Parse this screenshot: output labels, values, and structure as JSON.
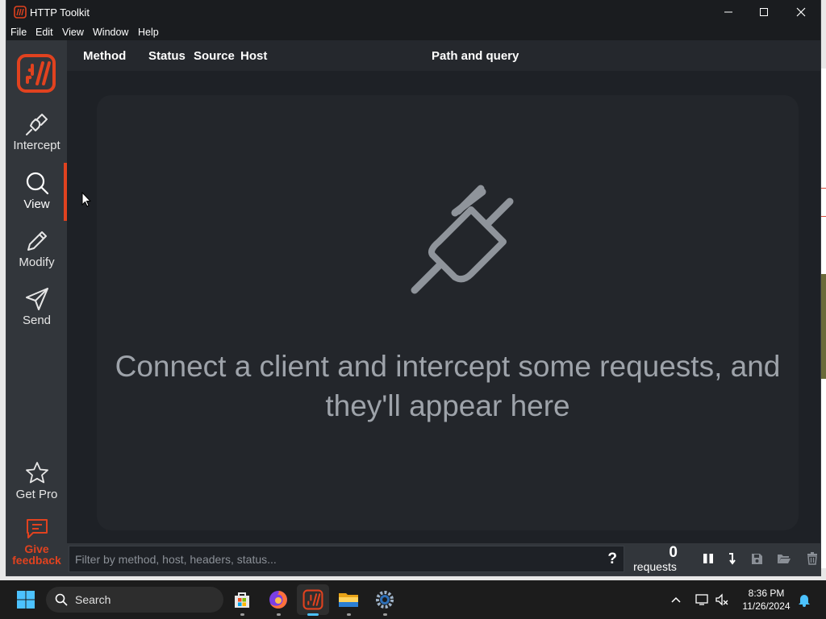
{
  "window": {
    "title": "HTTP Toolkit",
    "controls": [
      "minimize-icon",
      "maximize-icon",
      "close-icon"
    ]
  },
  "menu": [
    "File",
    "Edit",
    "View",
    "Window",
    "Help"
  ],
  "sidebar": {
    "items": [
      {
        "label": "Intercept",
        "icon": "plug-icon"
      },
      {
        "label": "View",
        "icon": "search-icon"
      },
      {
        "label": "Modify",
        "icon": "pencil-icon"
      },
      {
        "label": "Send",
        "icon": "send-icon"
      }
    ],
    "active": "View",
    "bottom": [
      {
        "label": "Get Pro",
        "icon": "star-icon"
      },
      {
        "label": "Give feedback",
        "icon": "feedback-icon"
      }
    ]
  },
  "columns": [
    "Method",
    "Status",
    "Source",
    "Host",
    "Path and query"
  ],
  "empty_state": {
    "icon": "plug-icon",
    "message": "Connect a client and intercept some requests, and they'll appear here"
  },
  "footer": {
    "filter_placeholder": "Filter by method, host, headers, status...",
    "help": "?",
    "request_count": "0",
    "request_label": "requests",
    "buttons": [
      "pause-icon",
      "scroll-to-end-icon",
      "save-icon",
      "open-folder-icon",
      "trash-icon"
    ]
  },
  "taskbar": {
    "search_label": "Search",
    "apps": [
      "start-icon",
      "microsoft-store-icon",
      "firefox-icon",
      "httptoolkit-icon",
      "file-explorer-icon",
      "settings-icon"
    ],
    "time": "8:36 PM",
    "date": "11/26/2024"
  },
  "colors": {
    "accent": "#e1421f",
    "sidebar_bg": "#32363b",
    "main_bg": "#1e2126",
    "text_muted": "#9ea3aa"
  }
}
